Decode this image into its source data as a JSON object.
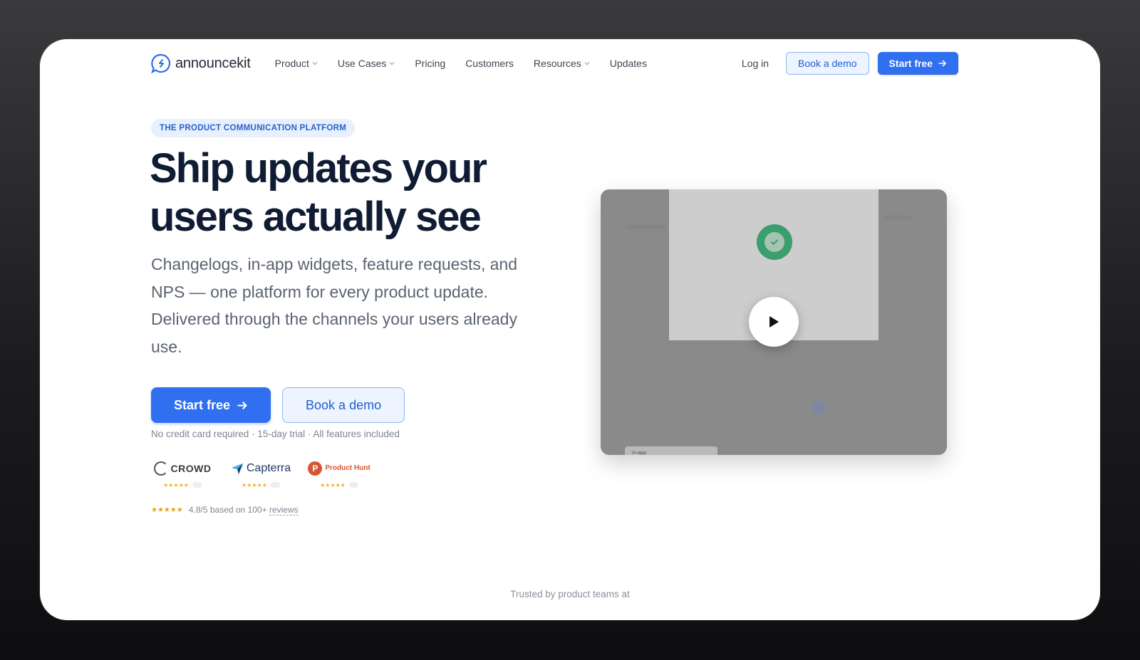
{
  "brand": {
    "name": "announcekit",
    "accent": "#2f6ff0",
    "dark_text": "#0f1c33"
  },
  "nav": {
    "items": [
      {
        "label": "Product",
        "has_dropdown": true
      },
      {
        "label": "Use Cases",
        "has_dropdown": true
      },
      {
        "label": "Pricing",
        "has_dropdown": false
      },
      {
        "label": "Customers",
        "has_dropdown": false
      },
      {
        "label": "Resources",
        "has_dropdown": true
      },
      {
        "label": "Updates",
        "has_dropdown": false
      }
    ],
    "login": "Log in",
    "book_demo": "Book a demo",
    "start_free": "Start free"
  },
  "hero": {
    "badge": "THE PRODUCT COMMUNICATION PLATFORM",
    "headline_line1": "Ship updates your",
    "headline_line2": "users actually see",
    "subhead": "Changelogs, in-app widgets, feature requests, and NPS — one platform for every product update. Delivered through the channels your users already use.",
    "cta_primary": "Start free",
    "cta_secondary": "Book a demo",
    "fineprint": "No credit card required · 15-day trial · All features included"
  },
  "reviews": {
    "sites": [
      {
        "name": "CROWD",
        "icon": "g2-crowd-logo-icon"
      },
      {
        "name": "Capterra",
        "icon": "capterra-logo-icon"
      },
      {
        "name": "Product Hunt",
        "icon": "product-hunt-logo-icon",
        "letter": "P"
      }
    ],
    "rating_stars": "★★★★★",
    "rating_text": "4.8/5 based on 100+",
    "rating_link": "reviews"
  },
  "video": {
    "tab_label": "In-app",
    "icons": [
      "check-icon",
      "play-icon"
    ]
  },
  "footer": {
    "trusted": "Trusted by product teams at"
  }
}
